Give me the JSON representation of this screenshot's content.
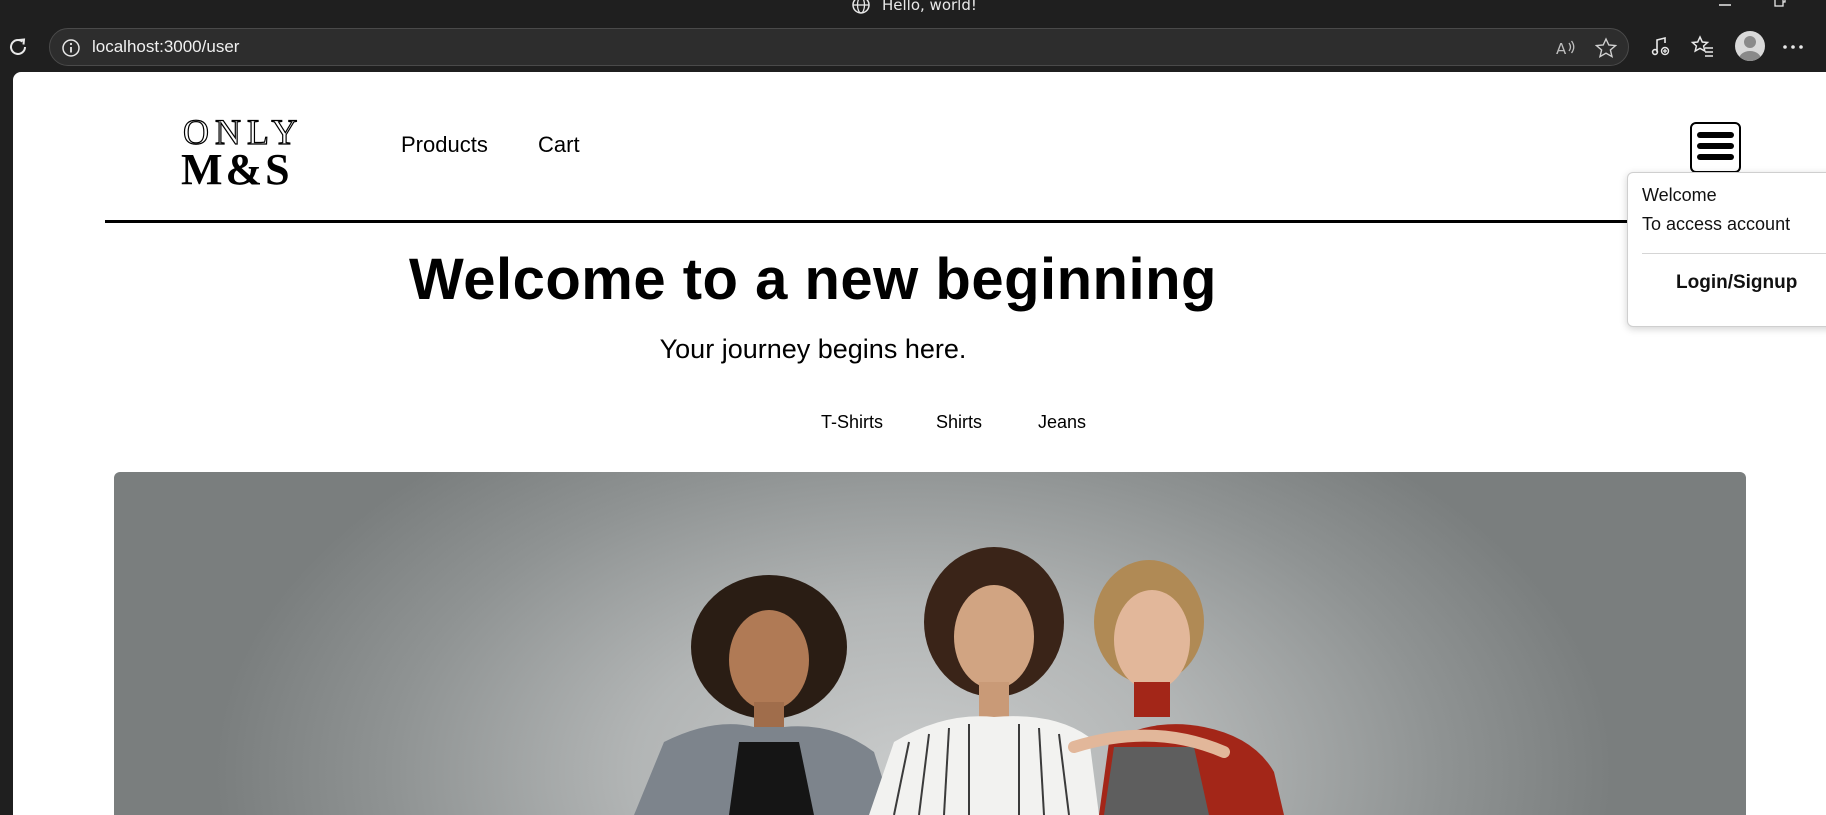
{
  "browser": {
    "window_title": "Hello, world!",
    "url": "localhost:3000/user"
  },
  "site": {
    "logo_line1": "ONLY",
    "logo_line2": "M&S",
    "nav": [
      {
        "label": "Products"
      },
      {
        "label": "Cart"
      }
    ]
  },
  "hero": {
    "title": "Welcome to a new beginning",
    "subtitle": "Your journey begins here."
  },
  "categories": [
    {
      "label": "T-Shirts"
    },
    {
      "label": "Shirts"
    },
    {
      "label": "Jeans"
    }
  ],
  "dropdown": {
    "welcome": "Welcome",
    "access": "To access account",
    "login": "Login/Signup"
  },
  "icons": {
    "menu": "hamburger-icon",
    "reload": "reload-icon",
    "info": "info-icon",
    "favorite": "star-icon",
    "more": "more-icon"
  },
  "colors": {
    "chrome_bg": "#1f1f1f",
    "address_bg": "#2d2d2d",
    "page_bg": "#ffffff",
    "text": "#000000"
  }
}
